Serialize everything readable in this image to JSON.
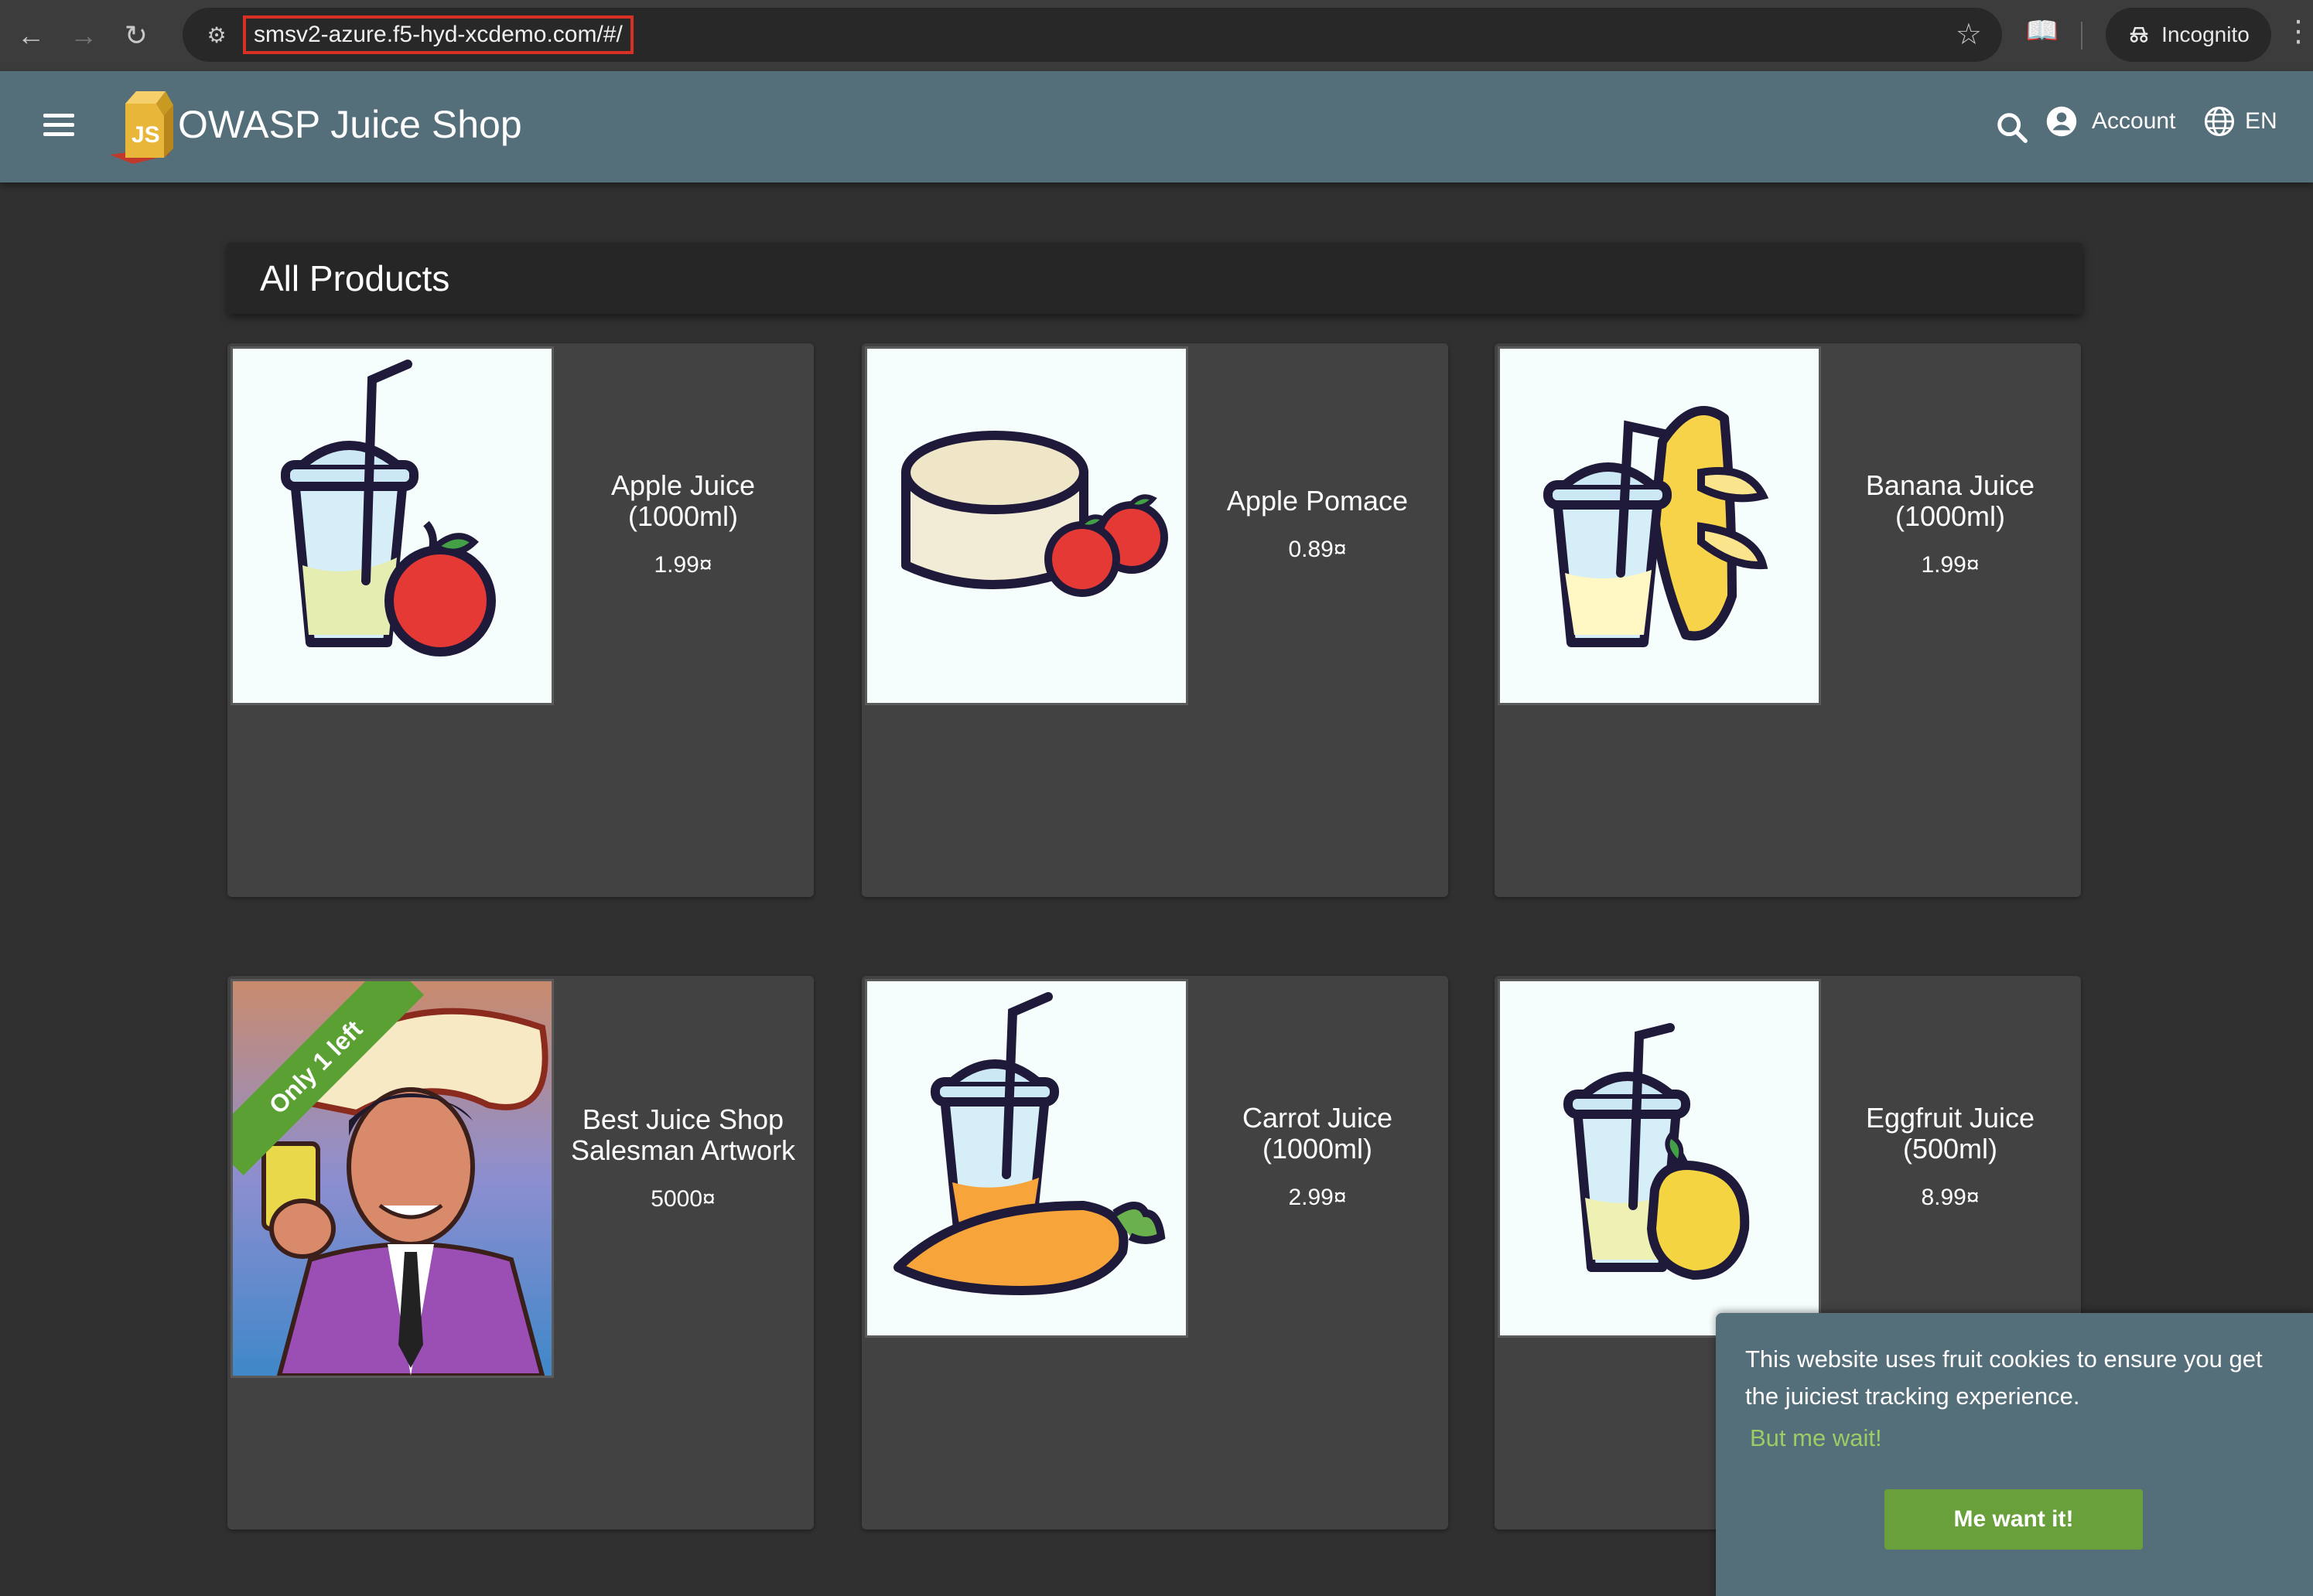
{
  "browser": {
    "url": "smsv2-azure.f5-hyd-xcdemo.com/#/",
    "incognito_label": "Incognito"
  },
  "toolbar": {
    "title": "OWASP Juice Shop",
    "account_label": "Account",
    "language_label": "EN"
  },
  "page": {
    "heading": "All Products"
  },
  "products": [
    {
      "name": "Apple Juice (1000ml)",
      "price": "1.99¤",
      "image": "apple-juice-icon"
    },
    {
      "name": "Apple Pomace",
      "price": "0.89¤",
      "image": "apple-pomace-icon"
    },
    {
      "name": "Banana Juice (1000ml)",
      "price": "1.99¤",
      "image": "banana-juice-icon"
    },
    {
      "name": "Best Juice Shop Salesman Artwork",
      "price": "5000¤",
      "image": "salesman-artwork",
      "ribbon": "Only 1 left"
    },
    {
      "name": "Carrot Juice (1000ml)",
      "price": "2.99¤",
      "image": "carrot-juice-icon"
    },
    {
      "name": "Eggfruit Juice (500ml)",
      "price": "8.99¤",
      "image": "eggfruit-juice-icon"
    }
  ],
  "cookie_banner": {
    "message": "This website uses fruit cookies to ensure you get the juiciest tracking experience.",
    "link_text": "But me wait!",
    "button_label": "Me want it!"
  },
  "colors": {
    "toolbar": "#546e7a",
    "background": "#303030",
    "card": "#424242",
    "ribbon": "#5aa032",
    "accept_button": "#69a03b"
  }
}
